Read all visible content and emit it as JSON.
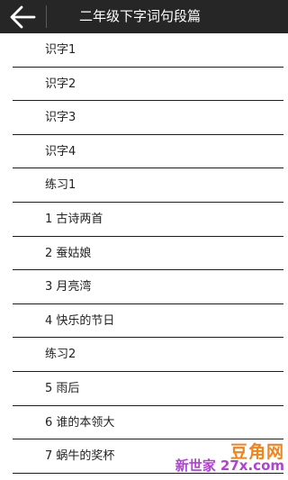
{
  "header": {
    "title": "二年级下字词句段篇",
    "back_icon": "arrow-left-icon"
  },
  "list": {
    "items": [
      "识字1",
      "识字2",
      "识字3",
      "识字4",
      "练习1",
      "1 古诗两首",
      "2 蚕姑娘",
      "3 月亮湾",
      "4 快乐的节日",
      "练习2",
      "5 雨后",
      "6 谁的本领大",
      "7 蜗牛的奖杯"
    ]
  },
  "watermark": {
    "brand": "豆角网",
    "site": "新世家 27x.com"
  },
  "colors": {
    "header_bg": "#262626",
    "divider": "#1e1e1e",
    "watermark_orange": "#f0841d",
    "watermark_purple": "#b23fd6"
  }
}
